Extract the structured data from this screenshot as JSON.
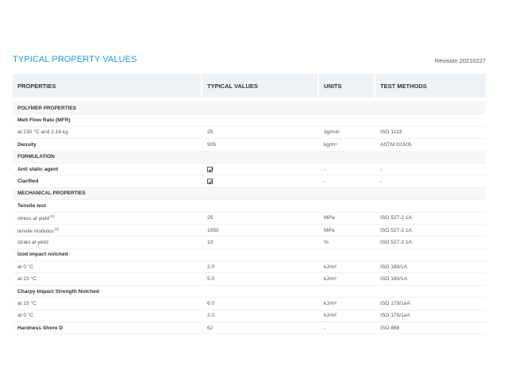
{
  "header": {
    "title": "TYPICAL PROPERTY VALUES",
    "revision": "Revision 20210227"
  },
  "table": {
    "columns": [
      "PROPERTIES",
      "TYPICAL VALUES",
      "UNITS",
      "TEST METHODS"
    ],
    "rows": [
      {
        "kind": "section",
        "property": "POLYMER PROPERTIES"
      },
      {
        "kind": "group",
        "property": "Melt Flow Rate (MFR)"
      },
      {
        "kind": "data",
        "property": "at 230 °C and 2.16 kg",
        "value": "25",
        "units": "dg/min",
        "method": "ISO 1133"
      },
      {
        "kind": "bold",
        "property": "Density",
        "value": "905",
        "units": "kg/m³",
        "method": "ASTM D1505"
      },
      {
        "kind": "section",
        "property": "FORMULATION"
      },
      {
        "kind": "bold",
        "property": "Anti static agent",
        "check": true,
        "units": "-",
        "method": "-"
      },
      {
        "kind": "bold",
        "property": "Clarified",
        "check": true,
        "units": "-",
        "method": "-"
      },
      {
        "kind": "section",
        "property": "MECHANICAL PROPERTIES"
      },
      {
        "kind": "group",
        "property": "Tensile test"
      },
      {
        "kind": "data",
        "property": "stress at yield",
        "sup": "(1)",
        "value": "25",
        "units": "MPa",
        "method": "ISO 527-2 1A"
      },
      {
        "kind": "data",
        "property": "tensile modulus",
        "sup": "(2)",
        "value": "1050",
        "units": "MPa",
        "method": "ISO 527-2 1A"
      },
      {
        "kind": "data",
        "property": "strain at yield",
        "value": "13",
        "units": "%",
        "method": "ISO 527-2 1A"
      },
      {
        "kind": "group",
        "property": "Izod impact notched"
      },
      {
        "kind": "data",
        "property": "at 0 °C",
        "value": "2.0",
        "units": "kJ/m²",
        "method": "ISO 180/1A"
      },
      {
        "kind": "data",
        "property": "at 23 °C",
        "value": "5.0",
        "units": "kJ/m²",
        "method": "ISO 180/1A"
      },
      {
        "kind": "group",
        "property": "Charpy Impact Strength Notched"
      },
      {
        "kind": "data",
        "property": "at 23 °C",
        "value": "6.0",
        "units": "kJ/m²",
        "method": "ISO 179/1eA"
      },
      {
        "kind": "data",
        "property": "at 0 °C",
        "value": "2.0",
        "units": "kJ/m²",
        "method": "ISO 179/1eA"
      },
      {
        "kind": "bold",
        "property": "Hardness Shore D",
        "value": "62",
        "units": "-",
        "method": "ISO 868"
      }
    ]
  }
}
